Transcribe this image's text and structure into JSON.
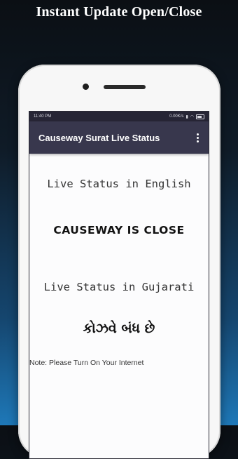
{
  "promo": {
    "title": "Instant Update Open/Close"
  },
  "statusbar": {
    "time": "11:40 PM",
    "speed": "0.00K/s"
  },
  "appbar": {
    "title": "Causeway Surat Live Status",
    "menu_icon": "more-vert-icon"
  },
  "main": {
    "heading_english": "Live Status in English",
    "status_english": "CAUSEWAY IS CLOSE",
    "heading_gujarati": "Live Status in Gujarati",
    "status_gujarati": "કોઝવે બંધ છે",
    "note": "Note: Please Turn On Your Internet"
  }
}
